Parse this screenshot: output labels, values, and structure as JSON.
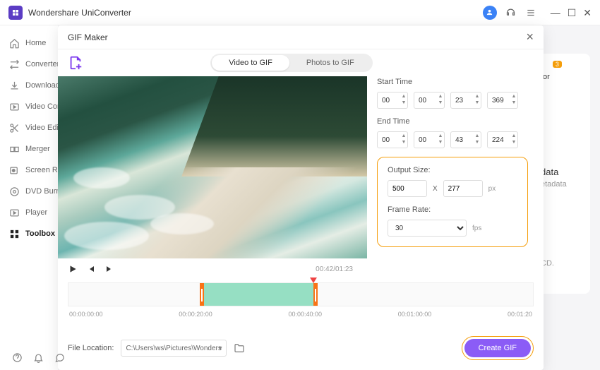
{
  "app": {
    "title": "Wondershare UniConverter"
  },
  "sidebar": {
    "items": [
      {
        "label": "Home"
      },
      {
        "label": "Converter"
      },
      {
        "label": "Downloader"
      },
      {
        "label": "Video Compressor"
      },
      {
        "label": "Video Editor"
      },
      {
        "label": "Merger"
      },
      {
        "label": "Screen Recorder"
      },
      {
        "label": "DVD Burner"
      },
      {
        "label": "Player"
      },
      {
        "label": "Toolbox"
      }
    ]
  },
  "bg": {
    "title": "tor",
    "badge": "3",
    "meta1": "data",
    "meta2": "etadata",
    "meta3": "CD."
  },
  "modal": {
    "title": "GIF Maker",
    "tabs": {
      "video": "Video to GIF",
      "photos": "Photos to GIF"
    },
    "player": {
      "current": "00:42",
      "total": "01:23"
    },
    "start": {
      "label": "Start Time",
      "h": "00",
      "m": "00",
      "s": "23",
      "ms": "369"
    },
    "end": {
      "label": "End Time",
      "h": "00",
      "m": "00",
      "s": "43",
      "ms": "224"
    },
    "output": {
      "label": "Output Size:",
      "w": "500",
      "x": "X",
      "h": "277",
      "unit": "px"
    },
    "frame": {
      "label": "Frame Rate:",
      "value": "30",
      "unit": "fps"
    },
    "ticks": [
      "00:00:00:00",
      "00:00:20:00",
      "00:00:40:00",
      "00:01:00:00",
      "00:01:20"
    ],
    "file": {
      "label": "File Location:",
      "path": "C:\\Users\\ws\\Pictures\\Wonders"
    },
    "create": "Create GIF"
  }
}
